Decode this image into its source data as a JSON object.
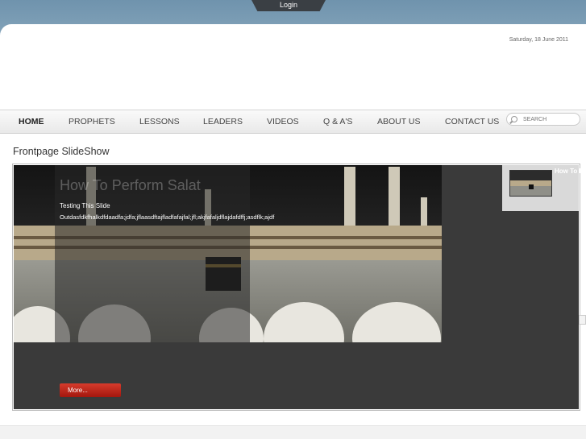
{
  "header": {
    "login_label": "Login",
    "date": "Saturday, 18 June 2011"
  },
  "nav": {
    "items": [
      {
        "label": "HOME",
        "active": true
      },
      {
        "label": "PROPHETS"
      },
      {
        "label": "LESSONS"
      },
      {
        "label": "LEADERS"
      },
      {
        "label": "VIDEOS"
      },
      {
        "label": "Q & A'S"
      },
      {
        "label": "ABOUT US"
      },
      {
        "label": "CONTACT US"
      }
    ],
    "search_placeholder": "SEARCH"
  },
  "main": {
    "section_title": "Frontpage SlideShow",
    "slide": {
      "title": "How To Perform Salat",
      "subtitle": "Testing This Slide",
      "description": "Outdasfdkfhalkdfdaadfa;jdfa;jflaasdftajfladfafajfal;jfl;akjfafaljdflajdafdffj;asdflk;ajdf",
      "more_label": "More..."
    },
    "thumb_label": "How To Perform Salat"
  }
}
